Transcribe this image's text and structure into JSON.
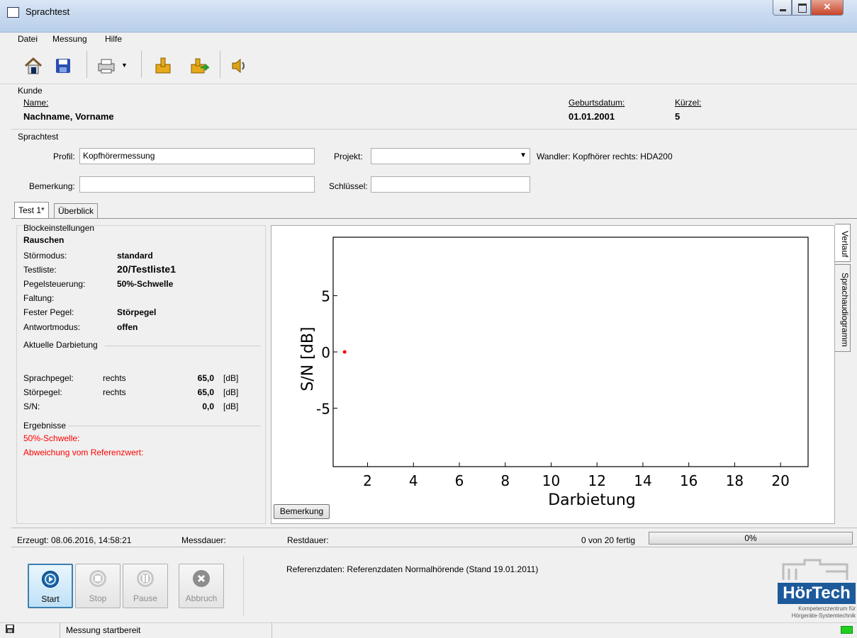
{
  "window": {
    "title": "Sprachtest"
  },
  "menu": [
    {
      "label": "Datei"
    },
    {
      "label": "Messung"
    },
    {
      "label": "Hilfe"
    }
  ],
  "toolbar": {
    "icons": [
      "home-icon",
      "save-icon",
      "print-icon",
      "import-icon",
      "export-icon",
      "speaker-icon"
    ]
  },
  "kunde": {
    "group_label": "Kunde",
    "name_label": "Name:",
    "name_value": "Nachname, Vorname",
    "geburtsdatum_label": "Geburtsdatum:",
    "geburtsdatum_value": "01.01.2001",
    "kuerzel_label": "Kürzel:",
    "kuerzel_value": "5"
  },
  "sprachtest": {
    "group_label": "Sprachtest",
    "profil_label": "Profil:",
    "profil_value": "Kopfhörermessung",
    "projekt_label": "Projekt:",
    "projekt_value": "",
    "wandler_text": "Wandler: Kopfhörer  rechts: HDA200",
    "bemerkung_label": "Bemerkung:",
    "bemerkung_value": "",
    "schluessel_label": "Schlüssel:",
    "schluessel_value": ""
  },
  "tabs": [
    {
      "label": "Test 1*"
    },
    {
      "label": "Überblick"
    }
  ],
  "block": {
    "group_label": "Blockeinstellungen",
    "title": "Rauschen",
    "rows": [
      {
        "label": "Störmodus:",
        "value": "standard"
      },
      {
        "label": "Testliste:",
        "value": "20/Testliste1"
      },
      {
        "label": "Pegelsteuerung:",
        "value": "50%-Schwelle"
      },
      {
        "label": "Faltung:",
        "value": ""
      },
      {
        "label": "Fester Pegel:",
        "value": "Störpegel"
      },
      {
        "label": "Antwortmodus:",
        "value": "offen"
      }
    ]
  },
  "darbietung": {
    "group_label": "Aktuelle Darbietung",
    "rows": [
      {
        "label": "Sprachpegel:",
        "side": "rechts",
        "value": "65,0",
        "unit": "[dB]"
      },
      {
        "label": "Störpegel:",
        "side": "rechts",
        "value": "65,0",
        "unit": "[dB]"
      },
      {
        "label": "S/N:",
        "side": "",
        "value": "0,0",
        "unit": "[dB]"
      }
    ]
  },
  "ergebnisse": {
    "group_label": "Ergebnisse",
    "schwelle_label": "50%-Schwelle:",
    "abweichung_label": "Abweichung vom Referenzwert:"
  },
  "chart_data": {
    "type": "scatter",
    "xlabel": "Darbietung",
    "ylabel": "S/N [dB]",
    "xlim": [
      0.5,
      21.2
    ],
    "ylim": [
      -10.2,
      10.2
    ],
    "xticks": [
      2,
      4,
      6,
      8,
      10,
      12,
      14,
      16,
      18,
      20
    ],
    "yticks": [
      5,
      0,
      -5
    ],
    "points": [
      {
        "x": 1,
        "y": 0
      }
    ],
    "point_color": "#ff0000",
    "grid": false
  },
  "chart_buttons": {
    "bemerkung": "Bemerkung"
  },
  "side_tabs": [
    {
      "label": "Verlauf"
    },
    {
      "label": "Sprachaudiogramm"
    }
  ],
  "status": {
    "erzeugt": "Erzeugt: 08.06.2016, 14:58:21",
    "messdauer": "Messdauer:",
    "restdauer": "Restdauer:",
    "fortschritt_text": "0 von 20 fertig",
    "progress_label": "0%",
    "progress": 0
  },
  "controls": [
    {
      "label": "Start",
      "icon": "play-icon",
      "enabled": true
    },
    {
      "label": "Stop",
      "icon": "stop-icon",
      "enabled": false
    },
    {
      "label": "Pause",
      "icon": "pause-icon",
      "enabled": false
    },
    {
      "label": "Abbruch",
      "icon": "cancel-icon",
      "enabled": false
    }
  ],
  "referenz_text": "Referenzdaten: Referenzdaten Normalhörende (Stand 19.01.2011)",
  "logo": {
    "name": "HörTech",
    "tagline1": "Kompetenzzentrum für",
    "tagline2": "Hörgeräte-Systemtechnik"
  },
  "statusbar": {
    "text": "Messung startbereit"
  },
  "colors": {
    "accent": "#1f6fb4",
    "error": "#ff0000",
    "logo_blue": "#1c5a9c"
  }
}
